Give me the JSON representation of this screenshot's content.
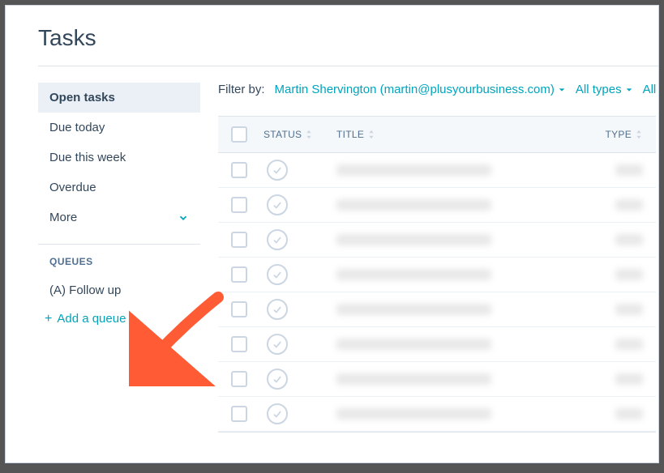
{
  "page": {
    "title": "Tasks"
  },
  "sidebar": {
    "items": [
      {
        "label": "Open tasks",
        "active": true
      },
      {
        "label": "Due today"
      },
      {
        "label": "Due this week"
      },
      {
        "label": "Overdue"
      },
      {
        "label": "More",
        "expandable": true
      }
    ],
    "queues_label": "QUEUES",
    "queues": [
      {
        "label": "(A) Follow up"
      }
    ],
    "add_queue_label": "Add a queue"
  },
  "filters": {
    "label": "Filter by:",
    "owner": "Martin Shervington (martin@plusyourbusiness.com)",
    "types": "All types",
    "partial": "All p"
  },
  "table": {
    "headers": {
      "status": "STATUS",
      "title": "TITLE",
      "type": "TYPE"
    },
    "row_count": 8
  }
}
